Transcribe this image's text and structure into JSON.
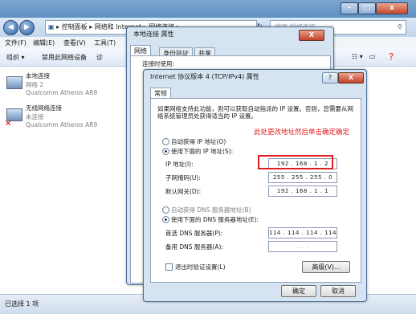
{
  "explorer": {
    "nav": {
      "back": "◀",
      "forward": "▶"
    },
    "breadcrumb": [
      "控制面板",
      "网络和 Internet",
      "网络连接"
    ],
    "search_placeholder": "搜索 网络连接",
    "menu": [
      "文件(F)",
      "编辑(E)",
      "查看(V)",
      "工具(T)"
    ],
    "toolbar": [
      "组织 ▾",
      "禁用此网络设备",
      "诊"
    ],
    "adapters": [
      {
        "name": "本地连接",
        "status": "网络 2",
        "device": "Qualcomm Atheros AR8"
      },
      {
        "name": "无线网络连接",
        "status": "未连接",
        "device": "Qualcomm Atheros AR9"
      }
    ],
    "status_text": "已选择 1 项"
  },
  "props_dialog": {
    "title": "本地连接 属性",
    "tabs": [
      "网络",
      "身份验证",
      "共享"
    ],
    "partial_text": "连接时使用:"
  },
  "ipv4_dialog": {
    "title": "Internet 协议版本 4 (TCP/IPv4) 属性",
    "tab": "常规",
    "intro": "如果网络支持此功能，则可以获取自动指派的 IP 设置。否则，您需要从网络系统管理员处获得适当的 IP 设置。",
    "auto_ip": "自动获得 IP 地址(O)",
    "manual_ip": "使用下面的 IP 地址(S):",
    "ip_label": "IP 地址(I):",
    "ip_value": "192 . 168 .   1  .   2",
    "mask_label": "子网掩码(U):",
    "mask_value": "255 . 255 . 255 .   0",
    "gw_label": "默认网关(D):",
    "gw_value": "192 . 168 .   1  .   1",
    "auto_dns": "自动获得 DNS 服务器地址(B)",
    "manual_dns": "使用下面的 DNS 服务器地址(E):",
    "dns1_label": "首选 DNS 服务器(P):",
    "dns1_value": "114 . 114 . 114 . 114",
    "dns2_label": "备用 DNS 服务器(A):",
    "dns2_value": " .   .   . ",
    "validate": "退出时验证设置(L)",
    "advanced": "高级(V)...",
    "ok": "确定",
    "cancel": "取消",
    "close_x": "X",
    "help_q": "?"
  },
  "annotation": "此处更改地址然后单击确定确定",
  "colors": {
    "annotation_red": "#e02020",
    "titlebar": "#5f8fc1"
  }
}
